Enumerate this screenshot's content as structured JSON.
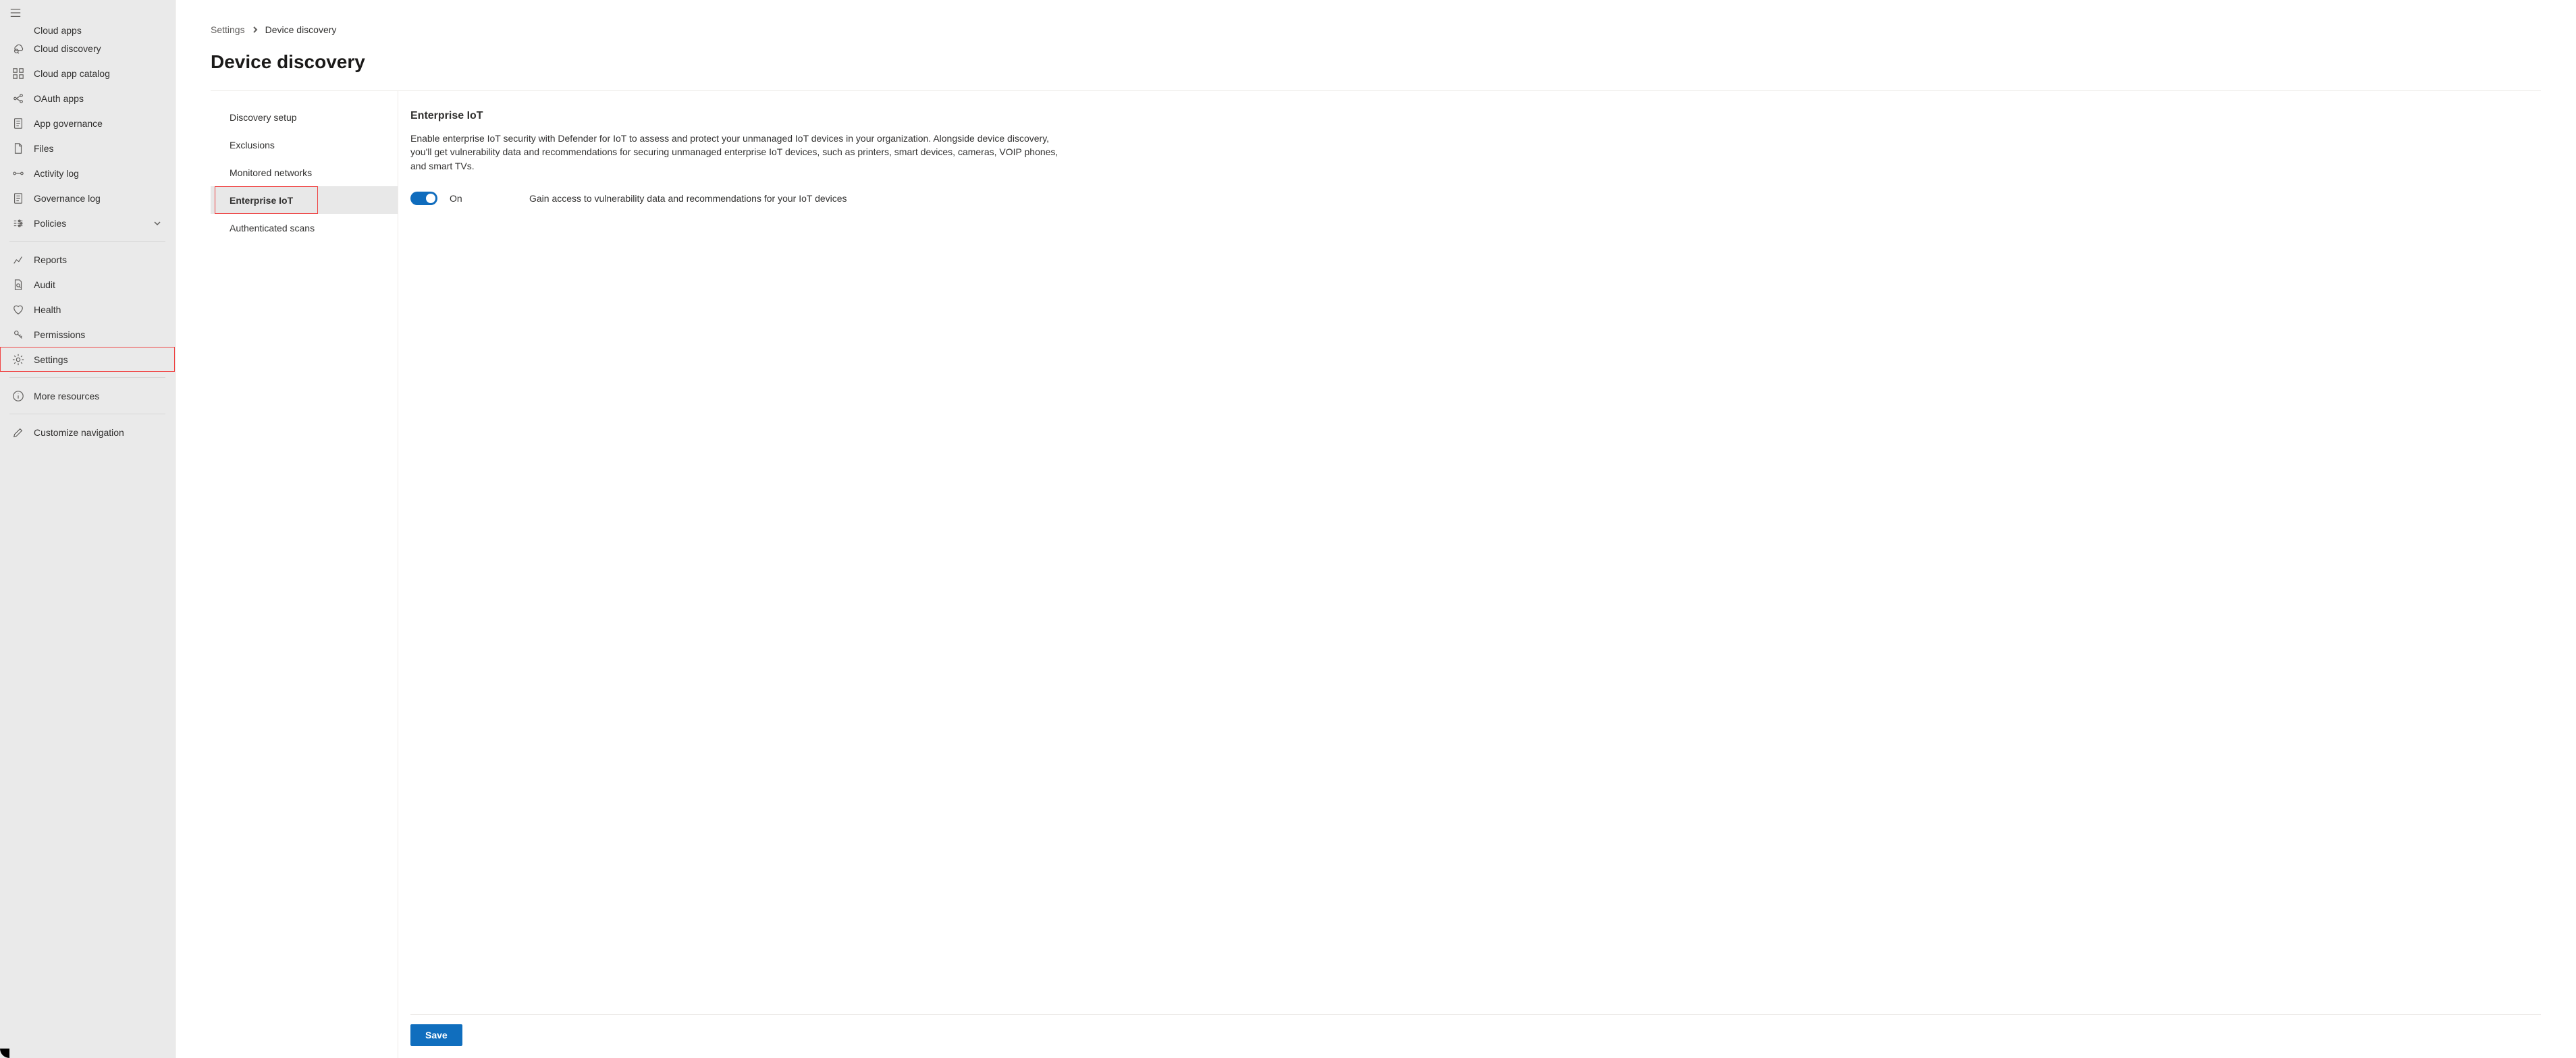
{
  "sidebar": {
    "items": [
      {
        "label": "Cloud apps",
        "icon": "cloud-apps",
        "cut": true
      },
      {
        "label": "Cloud discovery",
        "icon": "cloud-discovery"
      },
      {
        "label": "Cloud app catalog",
        "icon": "catalog"
      },
      {
        "label": "OAuth apps",
        "icon": "oauth"
      },
      {
        "label": "App governance",
        "icon": "governance"
      },
      {
        "label": "Files",
        "icon": "files"
      },
      {
        "label": "Activity log",
        "icon": "activity"
      },
      {
        "label": "Governance log",
        "icon": "governance-log"
      },
      {
        "label": "Policies",
        "icon": "policies",
        "expandable": true
      }
    ],
    "items2": [
      {
        "label": "Reports",
        "icon": "reports"
      },
      {
        "label": "Audit",
        "icon": "audit"
      },
      {
        "label": "Health",
        "icon": "health"
      },
      {
        "label": "Permissions",
        "icon": "permissions"
      },
      {
        "label": "Settings",
        "icon": "settings",
        "highlight": true
      }
    ],
    "items3": [
      {
        "label": "More resources",
        "icon": "info"
      }
    ],
    "items4": [
      {
        "label": "Customize navigation",
        "icon": "edit"
      }
    ]
  },
  "breadcrumb": {
    "root": "Settings",
    "current": "Device discovery"
  },
  "page": {
    "title": "Device discovery"
  },
  "tabs": [
    {
      "label": "Discovery setup"
    },
    {
      "label": "Exclusions"
    },
    {
      "label": "Monitored networks"
    },
    {
      "label": "Enterprise IoT",
      "active": true,
      "highlight": true
    },
    {
      "label": "Authenticated scans"
    }
  ],
  "section": {
    "title": "Enterprise IoT",
    "desc": "Enable enterprise IoT security with Defender for IoT to assess and protect your unmanaged IoT devices in your organization. Alongside device discovery, you'll get vulnerability data and recommendations for securing unmanaged enterprise IoT devices, such as printers, smart devices, cameras, VOIP phones, and smart TVs.",
    "toggle_state": "On",
    "toggle_desc": "Gain access to vulnerability data and recommendations for your IoT devices"
  },
  "footer": {
    "save_label": "Save"
  }
}
